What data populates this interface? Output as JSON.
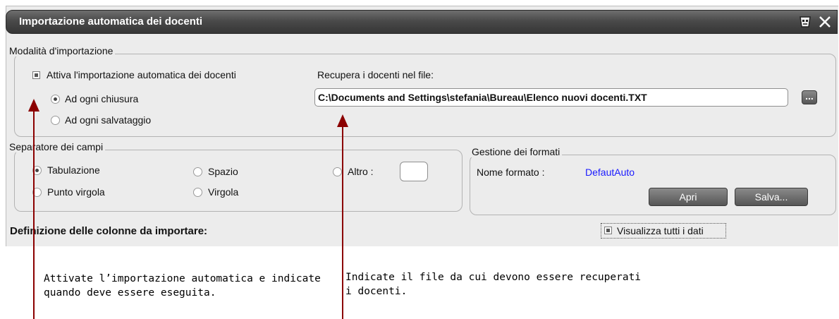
{
  "window": {
    "title": "Importazione automatica dei docenti"
  },
  "mode_group": {
    "legend": "Modalità d'importazione",
    "enable_label": "Attiva l'importazione automatica dei docenti",
    "radio_close": "Ad ogni chiusura",
    "radio_save": "Ad ogni salvataggio",
    "file_label": "Recupera i docenti nel file:",
    "file_value": "C:\\Documents and Settings\\stefania\\Bureau\\Elenco nuovi docenti.TXT",
    "browse_label": "..."
  },
  "separator_group": {
    "legend": "Separatore dei campi",
    "tab": "Tabulazione",
    "space": "Spazio",
    "other": "Altro :",
    "semicolon": "Punto virgola",
    "comma": "Virgola"
  },
  "format_group": {
    "legend": "Gestione dei formati",
    "name_label": "Nome formato :",
    "name_value": "DefautAuto",
    "open_button": "Apri",
    "save_button": "Salva..."
  },
  "columns_heading": "Definizione delle colonne da importare:",
  "show_all_label": "Visualizza tutti i dati",
  "annotations": {
    "left": [
      "Attivate l’importazione automatica e indicate",
      "quando deve essere eseguita."
    ],
    "right": [
      "Indicate il file da cui devono essere recuperati",
      "i docenti."
    ]
  },
  "colors": {
    "accent_line": "#8b0000",
    "link_value": "#1a1aff"
  }
}
